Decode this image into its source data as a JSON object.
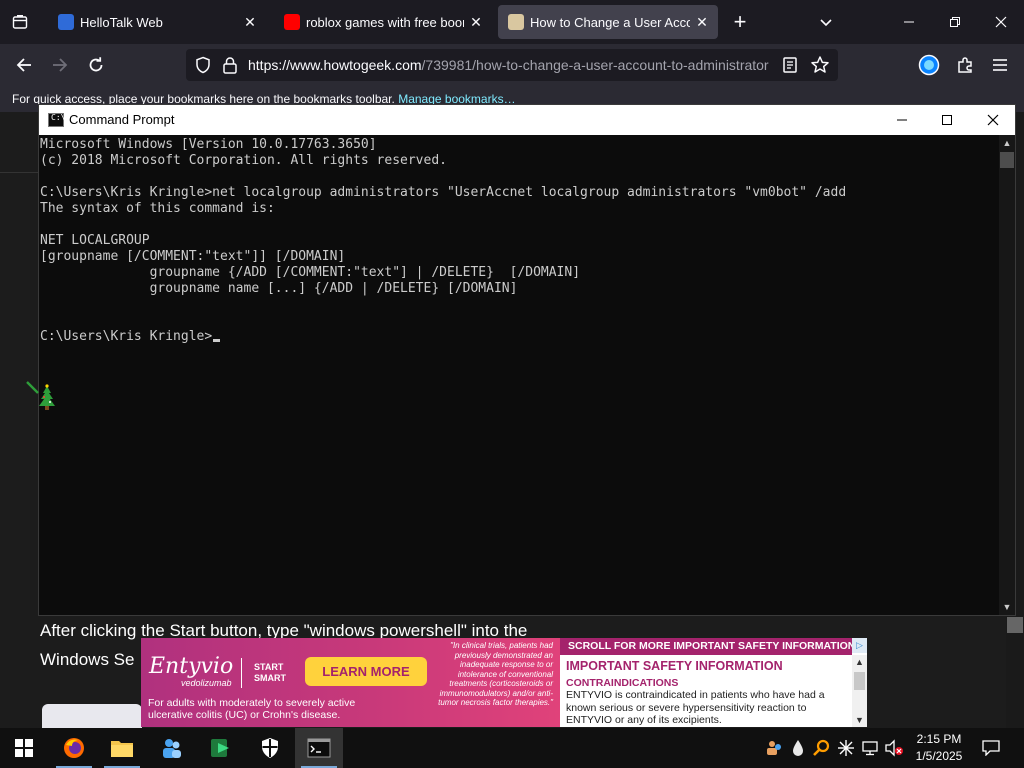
{
  "browser": {
    "tabs": [
      {
        "title": "HelloTalk Web",
        "active": false
      },
      {
        "title": "roblox games with free boombox",
        "active": false
      },
      {
        "title": "How to Change a User Account to Administrator",
        "active": true
      }
    ],
    "url_main": "https://www.howtogeek.com",
    "url_path": "/739981/how-to-change-a-user-account-to-administrator",
    "bookmarks_text": "For quick access, place your bookmarks here on the bookmarks toolbar.",
    "bookmarks_link": "Manage bookmarks…"
  },
  "webpage": {
    "article_text_1": "After clicking the Start button, type \"windows powershell\" into the",
    "article_text_2": "Windows Se"
  },
  "ad": {
    "brand": "Entyvio",
    "brand_sub": "vedolizumab",
    "start_1": "START",
    "start_2": "SMART",
    "cta": "LEARN MORE",
    "footnote": "For adults with moderately to severely active ulcerative colitis (UC) or Crohn's disease.",
    "quote": "\"In clinical trials, patients had previously demonstrated an inadequate response to or intolerance of conventional treatments (corticosteroids or immunomodulators) and/or anti-tumor necrosis factor therapies.\"",
    "right_header": "SCROLL FOR MORE IMPORTANT SAFETY INFORMATION",
    "right_title": "IMPORTANT SAFETY INFORMATION",
    "right_sub": "CONTRAINDICATIONS",
    "right_body": "ENTYVIO is contraindicated in patients who have had a known serious or severe hypersensitivity reaction to ENTYVIO or any of its excipients."
  },
  "cmd": {
    "title": "Command Prompt",
    "icon_text": "C:\\",
    "lines": [
      "Microsoft Windows [Version 10.0.17763.3650]",
      "(c) 2018 Microsoft Corporation. All rights reserved.",
      "",
      "C:\\Users\\Kris Kringle>net localgroup administrators \"UserAccnet localgroup administrators \"vm0bot\" /add",
      "The syntax of this command is:",
      "",
      "NET LOCALGROUP",
      "[groupname [/COMMENT:\"text\"]] [/DOMAIN]",
      "              groupname {/ADD [/COMMENT:\"text\"] | /DELETE}  [/DOMAIN]",
      "              groupname name [...] {/ADD | /DELETE} [/DOMAIN]",
      "",
      "",
      "C:\\Users\\Kris Kringle>"
    ]
  },
  "taskbar": {
    "time": "2:15 PM",
    "date": "1/5/2025"
  },
  "colors": {
    "browser_dark": "#1c1b22",
    "browser_toolbar": "#2b2a33",
    "link": "#80ebff",
    "console_bg": "#0c0c0c",
    "console_fg": "#cccccc",
    "ad_magenta": "#a4236c",
    "ad_cta": "#ffd23c"
  }
}
